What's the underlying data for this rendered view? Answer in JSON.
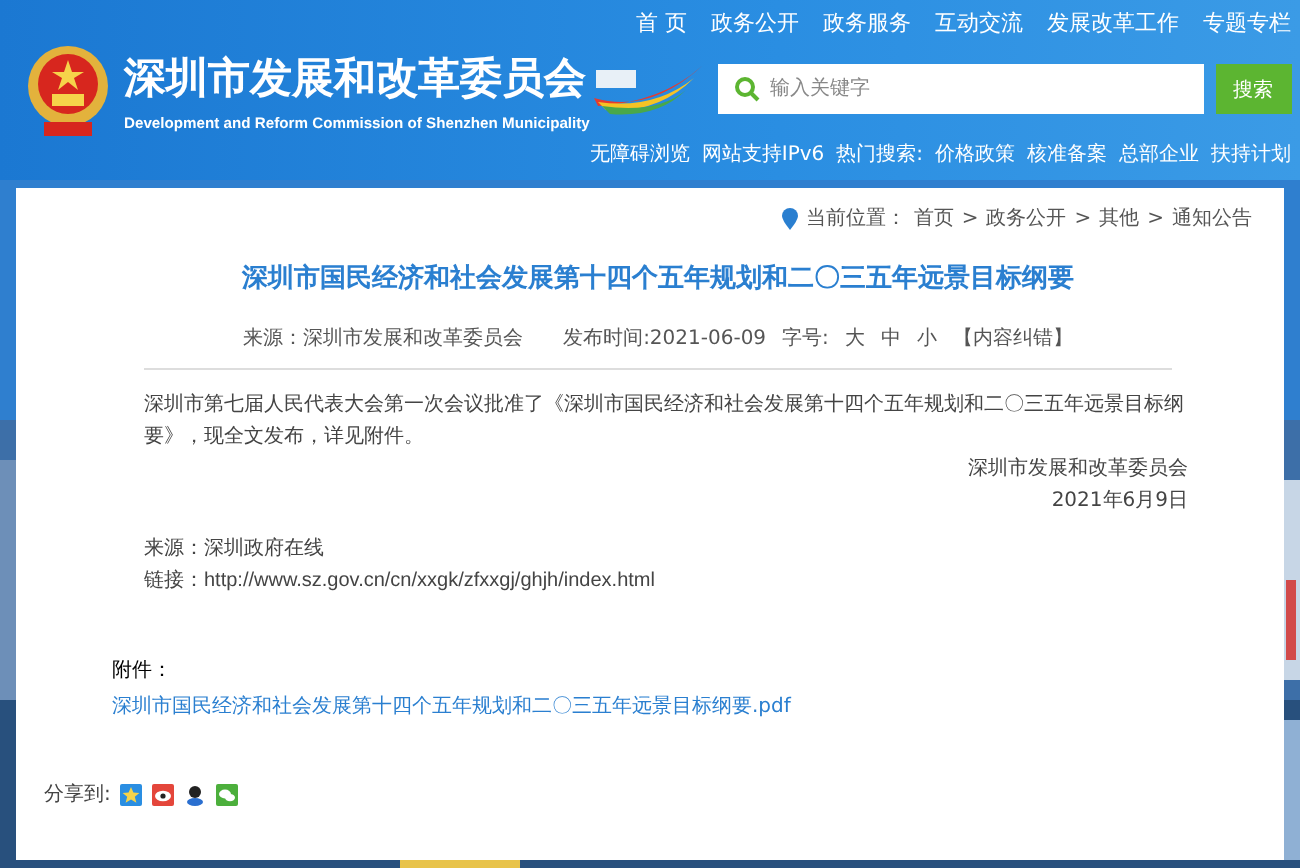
{
  "header": {
    "title": "深圳市发展和改革委员会",
    "subtitle": "Development and Reform Commission of Shenzhen Municipality",
    "nav": [
      "首 页",
      "政务公开",
      "政务服务",
      "互动交流",
      "发展改革工作",
      "专题专栏"
    ],
    "search": {
      "placeholder": "输入关键字",
      "button": "搜索"
    },
    "links": [
      "无障碍浏览",
      "网站支持IPv6"
    ],
    "hot_label": "热门搜索:",
    "hot": [
      "价格政策",
      "核准备案",
      "总部企业",
      "扶持计划"
    ]
  },
  "breadcrumb": {
    "label": "当前位置：",
    "items": [
      {
        "text": "首页",
        "sep": ">"
      },
      {
        "text": "政务公开",
        "sep": ">"
      },
      {
        "text": "其他",
        "sep": ">"
      },
      {
        "text": "通知公告"
      }
    ]
  },
  "article": {
    "title": "深圳市国民经济和社会发展第十四个五年规划和二〇三五年远景目标纲要",
    "meta": {
      "source": "来源：深圳市发展和改革委员会",
      "date": "发布时间:2021-06-09",
      "size_label": "字号:",
      "sizes": [
        "大",
        "中",
        "小"
      ],
      "correction": "【内容纠错】"
    },
    "body": "深圳市第七届人民代表大会第一次会议批准了《深圳市国民经济和社会发展第十四个五年规划和二〇三五年远景目标纲要》，现全文发布，详见附件。",
    "signature": "深圳市发展和改革委员会",
    "signed_date": "2021年6月9日",
    "source": "来源：深圳政府在线",
    "link_label": "链接：",
    "link": "http://www.sz.gov.cn/cn/xxgk/zfxxgj/ghjh/index.html"
  },
  "attachment": {
    "label": "附件：",
    "file": "深圳市国民经济和社会发展第十四个五年规划和二〇三五年远景目标纲要.pdf"
  },
  "share": {
    "label": "分享到:"
  }
}
